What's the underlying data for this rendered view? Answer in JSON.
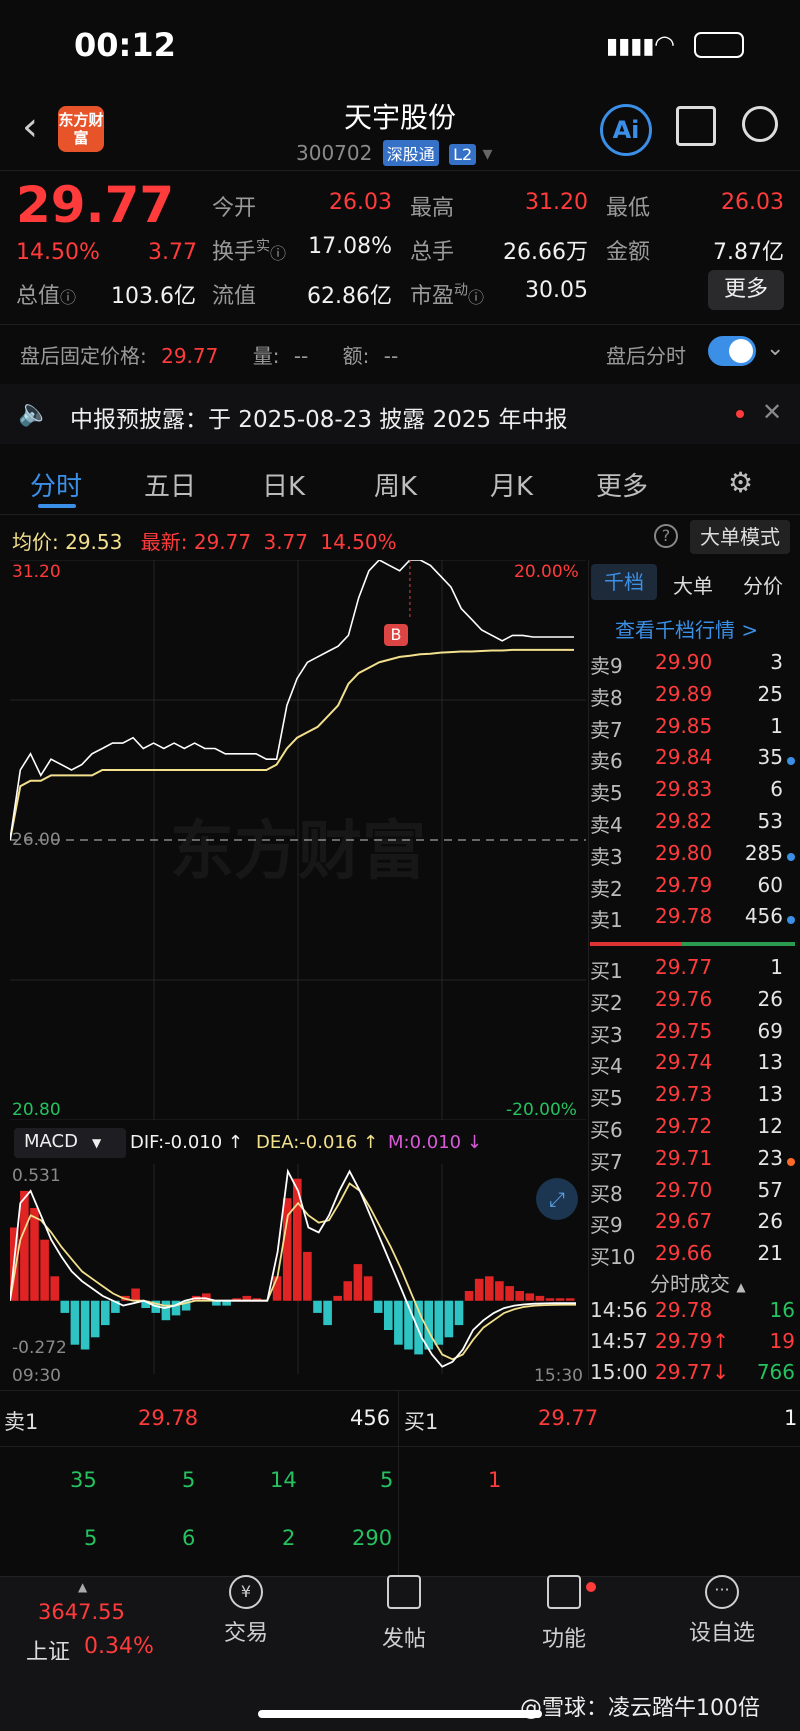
{
  "status": {
    "time": "00:12"
  },
  "header": {
    "title": "天宇股份",
    "code": "300702",
    "market": "深股通",
    "level": "L2",
    "logo_text": "东方财富",
    "ai_label": "Ai"
  },
  "quote": {
    "price": "29.77",
    "pct": "14.50%",
    "chg": "3.77",
    "open_label": "今开",
    "open": "26.03",
    "high_label": "最高",
    "high": "31.20",
    "low_label": "最低",
    "low": "26.03",
    "turnover_label": "换手",
    "turnover_sup": "实",
    "turnover": "17.08%",
    "vol_label": "总手",
    "vol": "26.66万",
    "amt_label": "金额",
    "amt": "7.87亿",
    "mcap_label": "总值",
    "mcap": "103.6亿",
    "float_label": "流值",
    "float": "62.86亿",
    "pe_label": "市盈",
    "pe_sup": "动",
    "pe": "30.05",
    "more": "更多"
  },
  "afterhours": {
    "label": "盘后固定价格:",
    "price": "29.77",
    "vol_label": "量:",
    "vol": "--",
    "amt_label": "额:",
    "amt": "--",
    "toggle_label": "盘后分时"
  },
  "notice": {
    "text": "中报预披露：于 2025-08-23 披露 2025 年中报"
  },
  "tabs": [
    "分时",
    "五日",
    "日K",
    "周K",
    "月K",
    "更多"
  ],
  "chart_info": {
    "avg_label": "均价:",
    "avg": "29.53",
    "last_label": "最新:",
    "last": "29.77",
    "chg": "3.77",
    "pct": "14.50%",
    "mode_btn": "大单模式"
  },
  "chart_data": {
    "type": "line",
    "y_top": "31.20",
    "y_mid": "26.00",
    "y_bottom": "20.80",
    "pct_top": "20.00%",
    "pct_bottom": "-20.00%",
    "x_start": "09:30",
    "x_end": "15:30",
    "watermark": "东方财富",
    "marker": "B",
    "ylim": [
      20.8,
      31.2
    ],
    "price": [
      26.0,
      27.3,
      27.6,
      27.2,
      27.5,
      27.4,
      27.3,
      27.4,
      27.6,
      27.7,
      27.8,
      27.8,
      27.9,
      27.7,
      27.8,
      27.7,
      27.8,
      27.7,
      27.8,
      27.7,
      27.7,
      27.6,
      27.6,
      27.6,
      27.6,
      27.5,
      27.5,
      28.5,
      29.0,
      29.3,
      29.4,
      29.5,
      29.6,
      29.8,
      30.5,
      31.0,
      31.2,
      31.1,
      31.0,
      31.2,
      31.2,
      31.1,
      30.9,
      30.7,
      30.3,
      30.1,
      29.9,
      29.8,
      29.7,
      29.8,
      29.8,
      29.77,
      29.77,
      29.77,
      29.77,
      29.77
    ],
    "avg": [
      26.0,
      27.0,
      27.1,
      27.1,
      27.2,
      27.2,
      27.2,
      27.2,
      27.2,
      27.3,
      27.3,
      27.3,
      27.3,
      27.3,
      27.3,
      27.3,
      27.3,
      27.3,
      27.3,
      27.3,
      27.3,
      27.3,
      27.3,
      27.3,
      27.3,
      27.3,
      27.4,
      27.7,
      27.9,
      28.0,
      28.1,
      28.3,
      28.5,
      28.9,
      29.1,
      29.2,
      29.3,
      29.35,
      29.4,
      29.42,
      29.45,
      29.46,
      29.48,
      29.49,
      29.5,
      29.5,
      29.51,
      29.52,
      29.52,
      29.53,
      29.53,
      29.53,
      29.53,
      29.53,
      29.53,
      29.53
    ]
  },
  "macd": {
    "label": "MACD",
    "dif": "DIF:-0.010 ↑",
    "dea": "DEA:-0.016 ↑",
    "m": "M:0.010 ↓",
    "top": "0.531",
    "bottom": "-0.272",
    "bars": [
      0.3,
      0.45,
      0.38,
      0.25,
      0.1,
      -0.05,
      -0.18,
      -0.2,
      -0.15,
      -0.1,
      -0.05,
      0.02,
      0.05,
      -0.03,
      -0.05,
      -0.08,
      -0.06,
      -0.04,
      0.02,
      0.03,
      -0.02,
      -0.02,
      0.01,
      0.02,
      0.01,
      0.0,
      0.1,
      0.42,
      0.5,
      0.2,
      -0.05,
      -0.1,
      0.02,
      0.08,
      0.15,
      0.1,
      -0.05,
      -0.12,
      -0.18,
      -0.2,
      -0.22,
      -0.2,
      -0.18,
      -0.15,
      -0.1,
      0.04,
      0.09,
      0.1,
      0.08,
      0.06,
      0.04,
      0.03,
      0.02,
      0.01,
      0.01,
      0.01
    ],
    "dif_line": [
      0.0,
      0.4,
      0.45,
      0.35,
      0.25,
      0.18,
      0.12,
      0.08,
      0.05,
      0.02,
      0.0,
      -0.02,
      -0.01,
      0.0,
      -0.02,
      -0.03,
      -0.02,
      0.0,
      0.01,
      0.01,
      0.0,
      0.0,
      0.0,
      0.0,
      0.0,
      0.0,
      0.2,
      0.53,
      0.45,
      0.3,
      0.28,
      0.35,
      0.45,
      0.53,
      0.45,
      0.35,
      0.25,
      0.15,
      0.05,
      -0.05,
      -0.15,
      -0.22,
      -0.27,
      -0.25,
      -0.2,
      -0.12,
      -0.08,
      -0.05,
      -0.03,
      -0.02,
      -0.015,
      -0.012,
      -0.011,
      -0.01,
      -0.01,
      -0.01
    ],
    "dea_line": [
      0.0,
      0.25,
      0.35,
      0.33,
      0.28,
      0.22,
      0.17,
      0.12,
      0.09,
      0.06,
      0.03,
      0.01,
      0.0,
      0.0,
      -0.01,
      -0.02,
      -0.02,
      -0.01,
      0.0,
      0.0,
      0.0,
      0.0,
      0.0,
      0.0,
      0.0,
      0.0,
      0.1,
      0.35,
      0.4,
      0.35,
      0.32,
      0.33,
      0.4,
      0.48,
      0.45,
      0.38,
      0.3,
      0.22,
      0.13,
      0.03,
      -0.07,
      -0.15,
      -0.22,
      -0.24,
      -0.22,
      -0.16,
      -0.11,
      -0.08,
      -0.05,
      -0.035,
      -0.025,
      -0.02,
      -0.018,
      -0.017,
      -0.016,
      -0.016
    ]
  },
  "orderbook": {
    "tabs": [
      "千档",
      "大单",
      "分价"
    ],
    "link": "查看千档行情 >",
    "asks": [
      {
        "l": "卖9",
        "p": "29.90",
        "v": "3"
      },
      {
        "l": "卖8",
        "p": "29.89",
        "v": "25"
      },
      {
        "l": "卖7",
        "p": "29.85",
        "v": "1"
      },
      {
        "l": "卖6",
        "p": "29.84",
        "v": "35"
      },
      {
        "l": "卖5",
        "p": "29.83",
        "v": "6"
      },
      {
        "l": "卖4",
        "p": "29.82",
        "v": "53"
      },
      {
        "l": "卖3",
        "p": "29.80",
        "v": "285"
      },
      {
        "l": "卖2",
        "p": "29.79",
        "v": "60"
      },
      {
        "l": "卖1",
        "p": "29.78",
        "v": "456"
      }
    ],
    "bids": [
      {
        "l": "买1",
        "p": "29.77",
        "v": "1"
      },
      {
        "l": "买2",
        "p": "29.76",
        "v": "26"
      },
      {
        "l": "买3",
        "p": "29.75",
        "v": "69"
      },
      {
        "l": "买4",
        "p": "29.74",
        "v": "13"
      },
      {
        "l": "买5",
        "p": "29.73",
        "v": "13"
      },
      {
        "l": "买6",
        "p": "29.72",
        "v": "12"
      },
      {
        "l": "买7",
        "p": "29.71",
        "v": "23"
      },
      {
        "l": "买8",
        "p": "29.70",
        "v": "57"
      },
      {
        "l": "买9",
        "p": "29.67",
        "v": "26"
      },
      {
        "l": "买10",
        "p": "29.66",
        "v": "21"
      }
    ],
    "trades_title": "分时成交",
    "trades": [
      {
        "t": "14:56",
        "p": "29.78",
        "v": "16"
      },
      {
        "t": "14:57",
        "p": "29.79↑",
        "v": "19"
      },
      {
        "t": "15:00",
        "p": "29.77↓",
        "v": "766"
      }
    ]
  },
  "queue": {
    "ask_label": "卖1",
    "ask_price": "29.78",
    "ask_vol": "456",
    "bid_label": "买1",
    "bid_price": "29.77",
    "bid_vol": "1",
    "ask_q1": [
      "35",
      "5",
      "14",
      "5"
    ],
    "ask_q2": [
      "5",
      "6",
      "2",
      "290"
    ],
    "bid_q1": [
      "1"
    ]
  },
  "nav": {
    "index_val": "3647.55",
    "index_name": "上证",
    "index_pct": "0.34%",
    "items": [
      "交易",
      "发帖",
      "功能",
      "设自选"
    ],
    "watermark": "@雪球：凌云踏牛100倍"
  },
  "colors": {
    "up": "#ff3b3b",
    "down": "#25c25f",
    "price_line": "#ffffff",
    "avg_line": "#f3e08c",
    "accent": "#3b8fe6"
  }
}
